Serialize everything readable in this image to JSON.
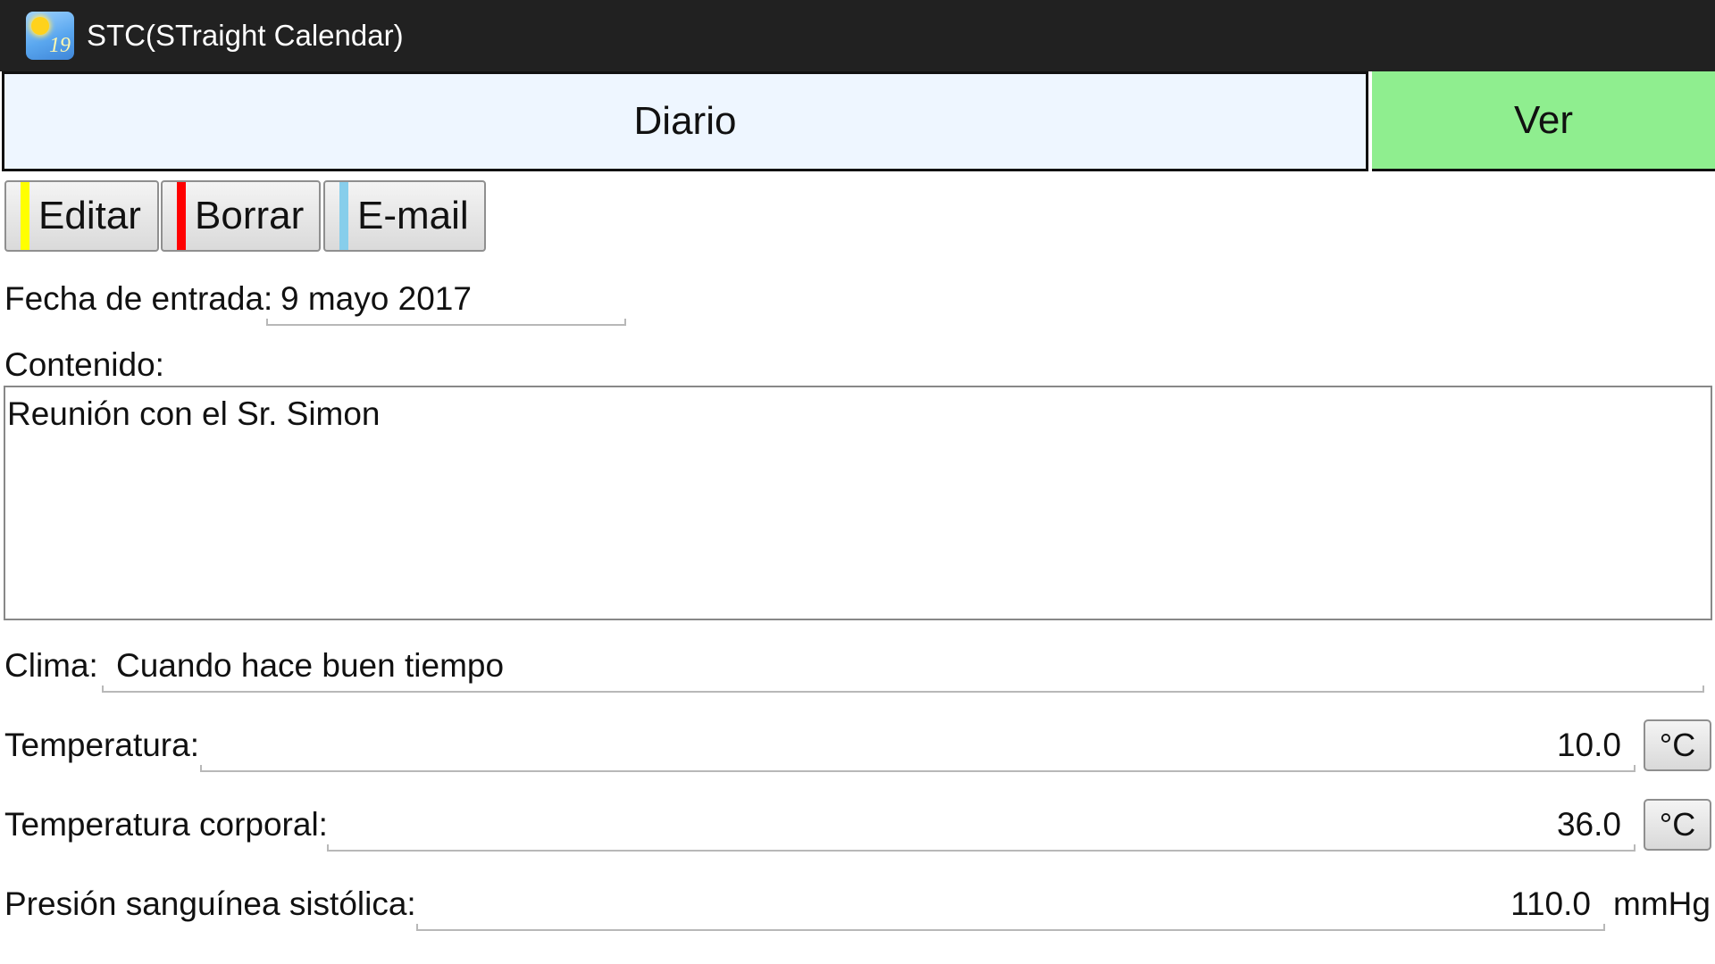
{
  "titlebar": {
    "app_name": "STC(STraight Calendar)",
    "icon_number": "19"
  },
  "tabs": {
    "diary_label": "Diario",
    "view_label": "Ver",
    "view_color": "#8fee8f",
    "diary_color": "#eef6ff"
  },
  "actions": {
    "edit_label": "Editar",
    "edit_color": "#ffff00",
    "delete_label": "Borrar",
    "delete_color": "#ff0000",
    "email_label": "E-mail",
    "email_color": "#87ceeb"
  },
  "form": {
    "date_label": "Fecha de entrada:",
    "date_value": "9 mayo 2017",
    "content_label": "Contenido:",
    "content_value": "Reunión con el Sr. Simon",
    "weather_label": "Clima:",
    "weather_value": "Cuando hace buen tiempo",
    "temperature_label": "Temperatura:",
    "temperature_value": "10.0",
    "temperature_unit": "°C",
    "body_temp_label": "Temperatura corporal:",
    "body_temp_value": "36.0",
    "body_temp_unit": "°C",
    "systolic_label": "Presión sanguínea sistólica:",
    "systolic_value": "110.0",
    "systolic_unit": "mmHg"
  }
}
